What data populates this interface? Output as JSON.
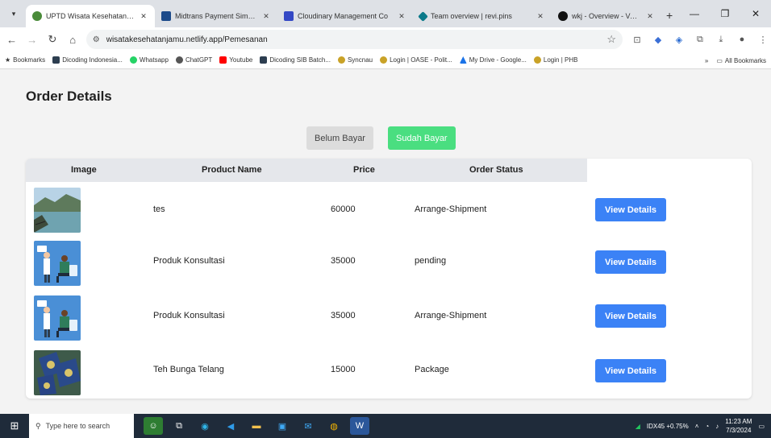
{
  "browser": {
    "tabs": [
      {
        "label": "UPTD Wisata Kesehatan Jam",
        "color": "#4a8b3a",
        "active": true
      },
      {
        "label": "Midtrans Payment Simulator",
        "color": "#1c4a8a",
        "active": false
      },
      {
        "label": "Cloudinary Management Co",
        "color": "#3448c5",
        "active": false
      },
      {
        "label": "Team overview | revi.pins",
        "color": "#0b7a8a",
        "active": false
      },
      {
        "label": "wkj - Overview - Vercel",
        "color": "#111111",
        "active": false
      }
    ],
    "new_tab": "+",
    "url": "wisatakesehatanjamu.netlify.app/Pemesanan",
    "bookmarks_label": "Bookmarks",
    "bookmarks": [
      {
        "label": "Dicoding Indonesia...",
        "color": "#2d3e50"
      },
      {
        "label": "Whatsapp",
        "color": "#25d366"
      },
      {
        "label": "ChatGPT",
        "color": "#555555"
      },
      {
        "label": "Youtube",
        "color": "#ff0000"
      },
      {
        "label": "Dicoding SIB Batch...",
        "color": "#2d3e50"
      },
      {
        "label": "Syncnau",
        "color": "#c9a227"
      },
      {
        "label": "Login | OASE - Polit...",
        "color": "#c9a227"
      },
      {
        "label": "My Drive - Google...",
        "color": "#1a73e8"
      },
      {
        "label": "Login | PHB",
        "color": "#c9a227"
      }
    ],
    "all_bookmarks": "All Bookmarks"
  },
  "page": {
    "title": "Order Details",
    "filters": {
      "unpaid": "Belum Bayar",
      "paid": "Sudah Bayar"
    },
    "table": {
      "headers": {
        "image": "Image",
        "product": "Product Name",
        "price": "Price",
        "status": "Order Status"
      },
      "rows": [
        {
          "product": "tes",
          "price": "60000",
          "status": "Arrange-Shipment",
          "action": "View Details",
          "image": "landscape"
        },
        {
          "product": "Produk Konsultasi",
          "price": "35000",
          "status": "pending",
          "action": "View Details",
          "image": "consultation"
        },
        {
          "product": "Produk Konsultasi",
          "price": "35000",
          "status": "Arrange-Shipment",
          "action": "View Details",
          "image": "consultation"
        },
        {
          "product": "Teh Bunga Telang",
          "price": "15000",
          "status": "Package",
          "action": "View Details",
          "image": "tea-package"
        }
      ]
    }
  },
  "taskbar": {
    "search_placeholder": "Type here to search",
    "weather": "IDX45 +0.75%",
    "time": "11:23 AM",
    "date": "7/3/2024"
  }
}
